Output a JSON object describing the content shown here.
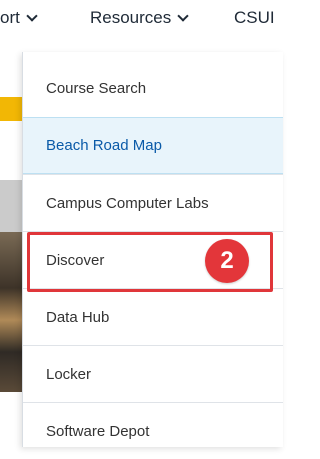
{
  "topnav": {
    "items": [
      {
        "label": "ort",
        "icon": "chevron-down-icon"
      },
      {
        "label": "Resources",
        "icon": "chevron-down-icon"
      },
      {
        "label": "CSUI"
      }
    ]
  },
  "dropdown": {
    "items": [
      {
        "label": "Course Search"
      },
      {
        "label": "Beach Road Map",
        "active": true
      },
      {
        "label": "Campus Computer Labs"
      },
      {
        "label": "Discover"
      },
      {
        "label": "Data Hub"
      },
      {
        "label": "Locker"
      },
      {
        "label": "Software Depot"
      }
    ]
  },
  "annotation": {
    "step_number": "2",
    "color": "#e3363a"
  },
  "colors": {
    "active_bg": "#e8f4fb",
    "active_text": "#0a5aa8",
    "accent_yellow": "#f2b705"
  }
}
